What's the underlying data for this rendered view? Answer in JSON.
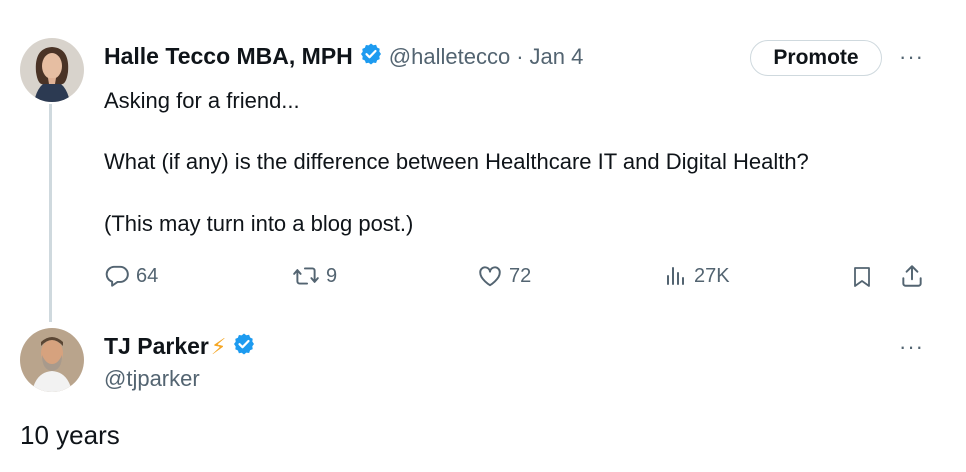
{
  "tweet": {
    "author_name": "Halle Tecco MBA, MPH",
    "handle": "@halletecco",
    "separator": "·",
    "date": "Jan 4",
    "promote_label": "Promote",
    "more_label": "···",
    "lines": [
      "Asking for a friend...",
      "What (if any) is the difference between Healthcare IT and Digital Health?",
      "(This may turn into a blog post.)"
    ],
    "actions": {
      "replies": "64",
      "reposts": "9",
      "likes": "72",
      "views": "27K"
    }
  },
  "reply": {
    "author_name": "TJ Parker",
    "emoji": "⚡",
    "handle": "@tjparker",
    "more_label": "···",
    "text": "10 years"
  },
  "colors": {
    "verified_badge": "#1d9bf0",
    "muted_text": "#536471",
    "thread_line": "#cfd9de"
  }
}
